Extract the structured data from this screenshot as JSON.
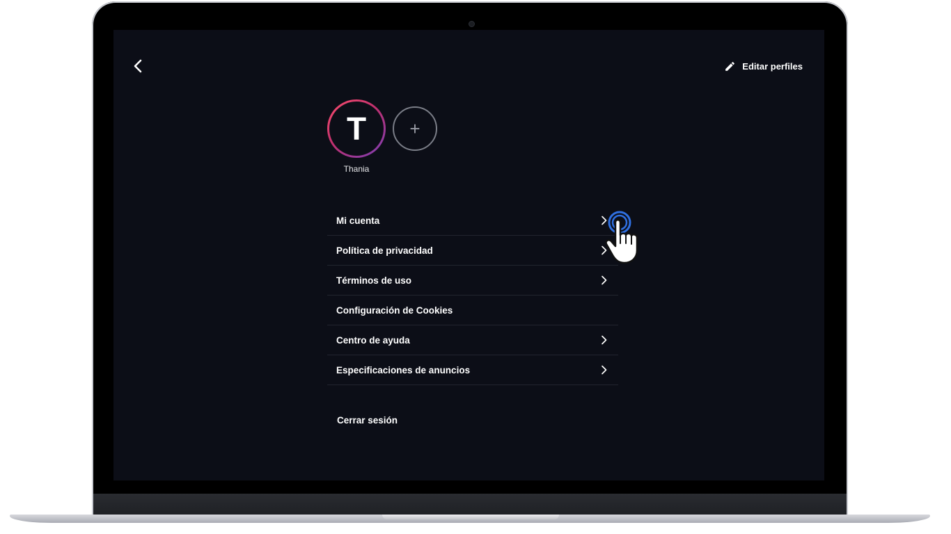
{
  "header": {
    "back_icon": "chevron-left-icon",
    "edit_profiles_label": "Editar perfiles",
    "edit_icon": "pencil-icon"
  },
  "profiles": {
    "items": [
      {
        "initial": "T",
        "name": "Thania"
      }
    ],
    "add_symbol": "+"
  },
  "menu": {
    "items": [
      {
        "label": "Mi cuenta",
        "has_chevron": true
      },
      {
        "label": "Política de privacidad",
        "has_chevron": true
      },
      {
        "label": "Términos de uso",
        "has_chevron": true
      },
      {
        "label": "Configuración de Cookies",
        "has_chevron": false
      },
      {
        "label": "Centro de ayuda",
        "has_chevron": true
      },
      {
        "label": "Especificaciones de anuncios",
        "has_chevron": true
      }
    ]
  },
  "logout_label": "Cerrar sesión",
  "colors": {
    "background": "#0c0e17",
    "text": "#ffffff",
    "avatar_gradient_start": "#ff4f6e",
    "avatar_gradient_end": "#7a3fb8",
    "divider": "#22252f",
    "click_ring": "#2f6fe0"
  }
}
